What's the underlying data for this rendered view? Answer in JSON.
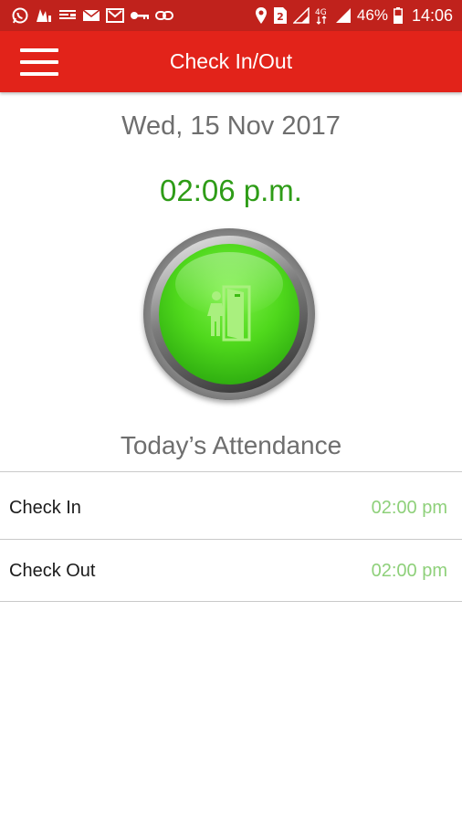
{
  "status_bar": {
    "left_icons": [
      "whatsapp-icon",
      "app-notification-icon",
      "news-icon",
      "mail-icon",
      "gmail-icon",
      "key-icon",
      "link-icon"
    ],
    "right_icons": [
      "location-icon",
      "sim-2-icon",
      "signal-icon",
      "4g-icon",
      "signal-icon",
      "battery-icon"
    ],
    "network_label": "4G",
    "sim_label": "2",
    "battery": "46%",
    "clock": "14:06",
    "background": "#c0221c"
  },
  "app_bar": {
    "title": "Check In/Out",
    "menu_icon": "hamburger-menu-icon",
    "background": "#e2231a"
  },
  "main": {
    "date": "Wed, 15 Nov 2017",
    "time": "02:06 p.m.",
    "time_color": "#2e9c17",
    "button_icon": "door-exit-icon",
    "button_color": "#4fd81c"
  },
  "attendance": {
    "title": "Today’s Attendance",
    "rows": [
      {
        "label": "Check In",
        "value": "02:00 pm"
      },
      {
        "label": "Check Out",
        "value": "02:00 pm"
      }
    ],
    "value_color": "#8ed07a"
  }
}
